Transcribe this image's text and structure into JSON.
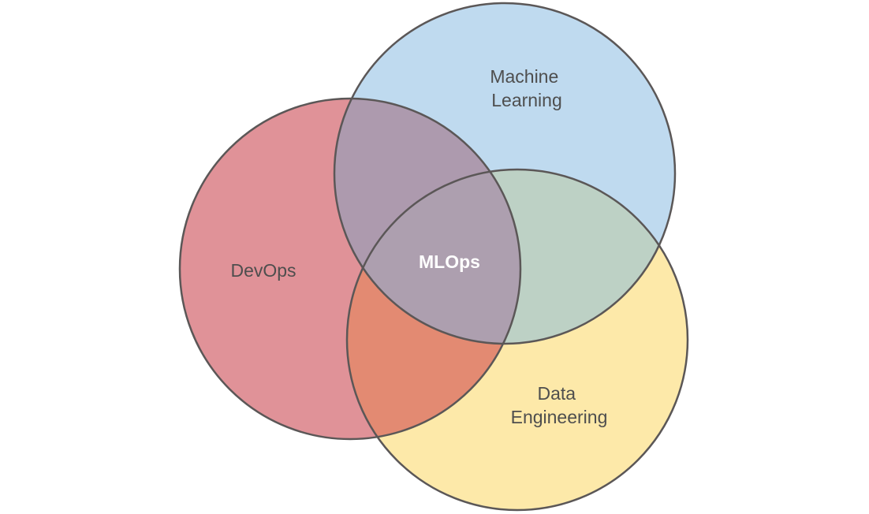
{
  "diagram": {
    "sets": {
      "devops": {
        "label": "DevOps",
        "color": "#e09298"
      },
      "machine_learning": {
        "label_lines": [
          "Machine",
          "Learning"
        ],
        "color": "#bfdaef"
      },
      "data_engineering": {
        "label_lines": [
          "Data",
          "Engineering"
        ],
        "color": "#fde9a9"
      }
    },
    "intersections": {
      "devops_ml": {
        "color": "#ad9aae"
      },
      "ml_data": {
        "color": "#bdd1c5"
      },
      "devops_data": {
        "color": "#e38a72"
      },
      "all_three": {
        "label": "MLOps",
        "color": "#ad9faf"
      }
    },
    "outline_color": "#5b5757"
  }
}
